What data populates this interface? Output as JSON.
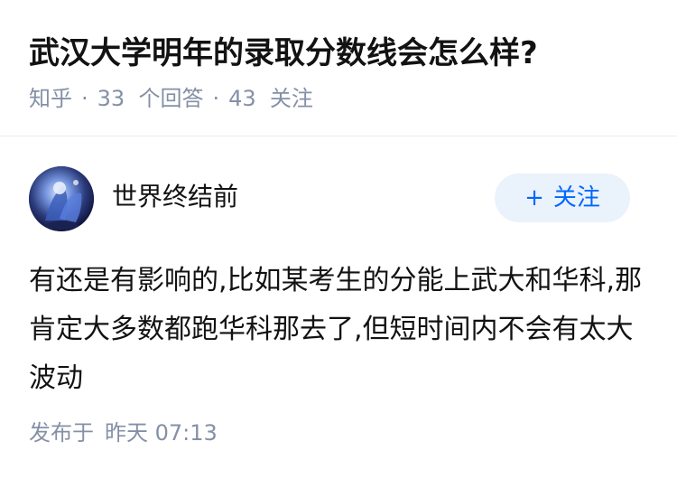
{
  "question": {
    "title": "武汉大学明年的录取分数线会怎么样?",
    "source": "知乎",
    "separator": "·",
    "answers_count": "33",
    "answers_label": "个回答",
    "followers_count": "43",
    "followers_label": "关注"
  },
  "answer": {
    "author": {
      "name": "世界终结前",
      "avatar_icon": "avatar-image"
    },
    "follow_button": {
      "icon": "+",
      "label": "关注"
    },
    "content": "有还是有影响的,比如某考生的分能上武大和华科,那肯定大多数都跑华科那去了,但短时间内不会有太大波动",
    "published_label": "发布于",
    "published_time": "昨天 07:13"
  },
  "colors": {
    "title_text": "#121212",
    "meta_text": "#8590a6",
    "follow_bg": "#eaf2fc",
    "follow_text": "#0066ff",
    "divider": "#ebebeb"
  }
}
